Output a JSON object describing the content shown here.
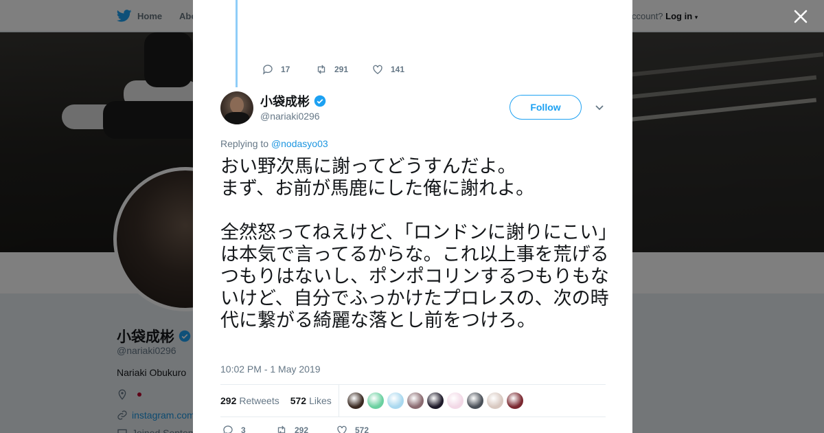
{
  "topbar": {
    "home_label": "Home",
    "about_label": "Abo",
    "account_prompt": "ccount?",
    "login_label": "Log in"
  },
  "profile": {
    "name": "小袋成彬",
    "handle": "@nariaki0296",
    "bio": "Nariaki Obukuro",
    "website": "instagram.com",
    "joined": "Joined Septem"
  },
  "tweet": {
    "prev_actions": {
      "replies": "17",
      "retweets": "291",
      "likes": "141"
    },
    "author_name": "小袋成彬",
    "author_handle": "@nariaki0296",
    "follow_label": "Follow",
    "replying_prefix": "Replying to",
    "replying_to": "@nodasyo03",
    "text": "おい野次馬に謝ってどうすんだよ。\nまず、お前が馬鹿にした俺に謝れよ。\n\n全然怒ってねえけど、「ロンドンに謝りにこい」は本気で言ってるからな。これ以上事を荒げるつもりはないし、ポンポコリンするつもりもないけど、自分でふっかけたプロレスの、次の時代に繋がる綺麗な落とし前をつけろ。",
    "timestamp": "10:02 PM - 1 May 2019",
    "retweets_count": "292",
    "retweets_label": "Retweets",
    "likes_count": "572",
    "likes_label": "Likes",
    "actions": {
      "replies": "3",
      "retweets": "292",
      "likes": "572"
    }
  },
  "colors": {
    "accent": "#1da1f2",
    "verified": "#1da1f2",
    "thread_line": "#8ecdf8"
  },
  "likers": [
    {
      "name": "liker-1",
      "color": "#3a2a22"
    },
    {
      "name": "liker-2",
      "color": "#6ad0a0"
    },
    {
      "name": "liker-3",
      "color": "#a9d8ef"
    },
    {
      "name": "liker-4",
      "color": "#8a6a70"
    },
    {
      "name": "liker-5",
      "color": "#1e1a2a"
    },
    {
      "name": "liker-6",
      "color": "#f2d8e6"
    },
    {
      "name": "liker-7",
      "color": "#4a5058"
    },
    {
      "name": "liker-8",
      "color": "#d8c8c0"
    },
    {
      "name": "liker-9",
      "color": "#7a2830"
    }
  ]
}
